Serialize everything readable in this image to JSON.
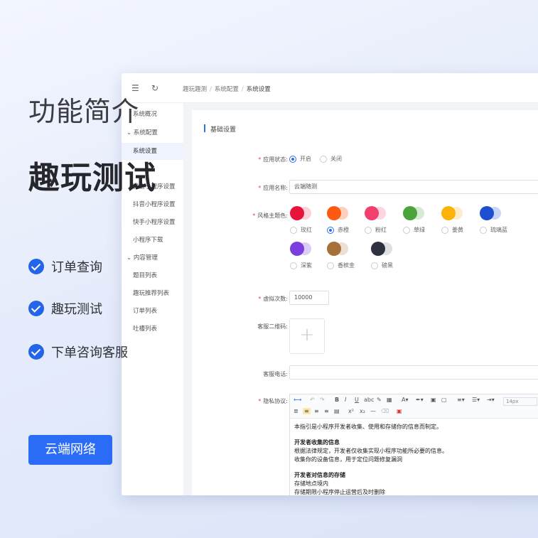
{
  "hero": {
    "title": "功能简介",
    "subtitle": "趣玩测试",
    "features": [
      "订单查询",
      "趣玩测试",
      "下单咨询客服"
    ],
    "brand_button": "云端网络"
  },
  "topbar": {
    "menu_icon": "menu-fold-icon",
    "refresh_icon": "refresh-icon",
    "breadcrumb": [
      "趣玩趣测",
      "系统配置",
      "系统设置"
    ]
  },
  "sidebar": {
    "items": [
      {
        "label": "系统概况",
        "type": "item"
      },
      {
        "label": "系统配置",
        "type": "group"
      },
      {
        "label": "系统设置",
        "type": "item",
        "active": true
      },
      {
        "label": "微信小程序设置",
        "type": "item"
      },
      {
        "label": "抖音小程序设置",
        "type": "item"
      },
      {
        "label": "快手小程序设置",
        "type": "item"
      },
      {
        "label": "小程序下载",
        "type": "item"
      },
      {
        "label": "内容管理",
        "type": "group"
      },
      {
        "label": "题目列表",
        "type": "item"
      },
      {
        "label": "趣玩推荐列表",
        "type": "item"
      },
      {
        "label": "订单列表",
        "type": "item"
      },
      {
        "label": "吐槽列表",
        "type": "item"
      }
    ]
  },
  "form": {
    "section_title": "基础设置",
    "app_status": {
      "label": "应用状态:",
      "options": [
        "开启",
        "关闭"
      ],
      "selected": "开启"
    },
    "app_name": {
      "label": "应用名称:",
      "value": "云端随测"
    },
    "theme_color": {
      "label": "风格主题色:",
      "selected": "赤橙",
      "colors": [
        {
          "name": "玫红",
          "c1": "#e8133b",
          "c2": "#fbd2da"
        },
        {
          "name": "赤橙",
          "c1": "#fb5a10",
          "c2": "#fdd0bd"
        },
        {
          "name": "粉红",
          "c1": "#f23f6e",
          "c2": "#fcd5e0"
        },
        {
          "name": "草绿",
          "c1": "#4aa33b",
          "c2": "#d6ecd2"
        },
        {
          "name": "姜黄",
          "c1": "#fbb30a",
          "c2": "#fdeccc"
        },
        {
          "name": "琉璃蓝",
          "c1": "#1e4fd0",
          "c2": "#c8d6f6"
        },
        {
          "name": "深紫",
          "c1": "#7a3fdc",
          "c2": "#dccdf7"
        },
        {
          "name": "香槟金",
          "c1": "#a6703c",
          "c2": "#ecdfd2"
        },
        {
          "name": "磅黑",
          "c1": "#2d323e",
          "c2": "#dfe0e3"
        }
      ]
    },
    "virtual_count": {
      "label": "虚拟次数:",
      "value": "10000"
    },
    "service_qr": {
      "label": "客服二维码:",
      "upload_icon": "plus-icon"
    },
    "service_phone": {
      "label": "客服电话:",
      "value": ""
    },
    "privacy": {
      "label": "隐私协议:",
      "font_size": "14px",
      "content": [
        {
          "text": "本指引是小程序开发者收集、使用和存储你的信息而制定。",
          "bold": false
        },
        {
          "text": "",
          "bold": false
        },
        {
          "text": "开发者收集的信息",
          "bold": true
        },
        {
          "text": "根据法律规定，开发者仅收集实现小程序功能所必要的信息。",
          "bold": false
        },
        {
          "text": "收集你的设备信息，用于定位问题修复漏洞",
          "bold": false
        },
        {
          "text": "",
          "bold": false
        },
        {
          "text": "开发者对信息的存储",
          "bold": true
        },
        {
          "text": "存储地点境内",
          "bold": false
        },
        {
          "text": "存储期限小程序停止运营后及时删除",
          "bold": false
        }
      ]
    }
  }
}
